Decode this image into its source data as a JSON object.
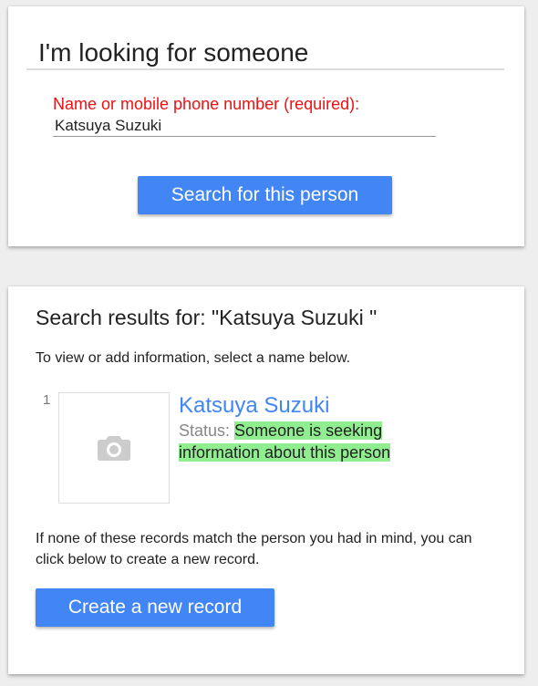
{
  "search_form": {
    "title": "I'm looking for someone",
    "field_label": "Name or mobile phone number (required):",
    "field_value": "Katsuya Suzuki",
    "search_button_label": "Search for this person"
  },
  "results": {
    "heading": "Search results for: \"Katsuya Suzuki \"",
    "instructions": "To view or add information, select a name below.",
    "items": [
      {
        "index": "1",
        "photo_icon": "camera-icon",
        "name": "Katsuya Suzuki",
        "status_label": "Status:",
        "status_value": "Someone is seeking information about this person"
      }
    ],
    "no_match_text": "If none of these records match the person you had in mind, you can click below to create a new record.",
    "create_button_label": "Create a new record"
  },
  "colors": {
    "accent": "#4285f4",
    "required_label": "#ee1111",
    "status_highlight": "#90ee90",
    "page_background": "#eeeeee"
  }
}
